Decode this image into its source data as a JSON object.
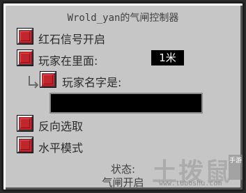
{
  "window": {
    "title": "Wrold_yan的气闸控制器"
  },
  "options": {
    "redstone_open": "红石信号开启",
    "player_inside": "玩家在里面:",
    "distance_value": "1米",
    "player_name": "玩家名字是:",
    "player_name_value": "",
    "invert": "反向选取",
    "horizontal": "水平模式"
  },
  "status": {
    "label": "状态:",
    "value": "气闸开启"
  },
  "watermark": {
    "logo": "土拨鼠",
    "badge": "手游",
    "url": "www.tuboshu.com"
  },
  "colors": {
    "checkbox": "#c0262d",
    "panel": "#c6c6c6",
    "field": "#000000"
  }
}
